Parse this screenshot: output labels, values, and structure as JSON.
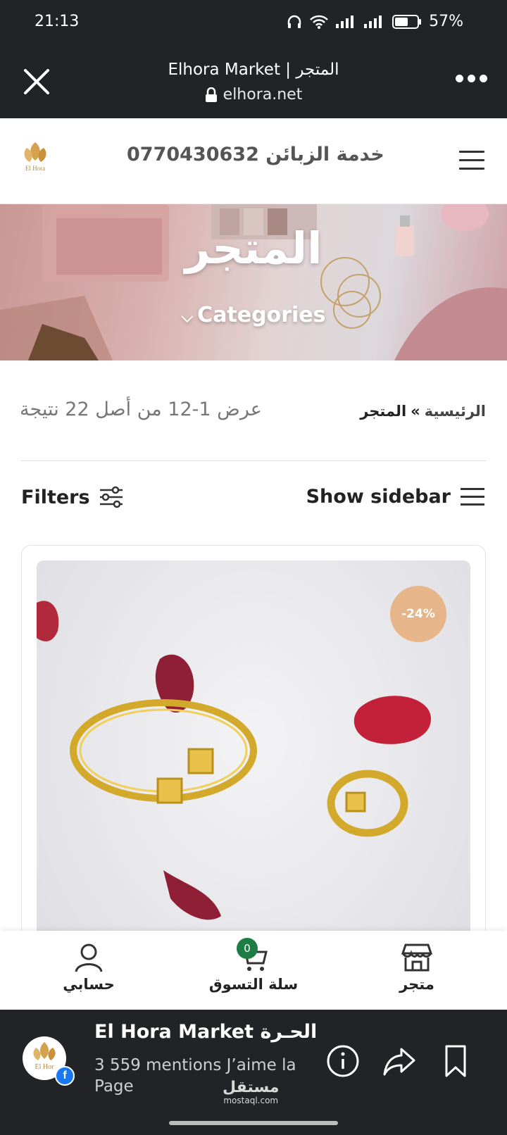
{
  "status_bar": {
    "time": "21:13",
    "battery": "57%"
  },
  "browser": {
    "title": "Elhora Market | المتجر",
    "url": "elhora.net"
  },
  "header": {
    "support_text": "خدمة الزبائن  0770430632",
    "logo_text": "El Hora"
  },
  "hero": {
    "title": "المتجر",
    "categories_label": "Categories"
  },
  "breadcrumb": {
    "home": "الرئيسية",
    "separator": "»",
    "current": "المتجر"
  },
  "result_count": "عرض 1-12 من أصل 22 نتيجة",
  "toolbar": {
    "filters_label": "Filters",
    "sidebar_label": "Show sidebar"
  },
  "product": {
    "sale_badge": "-24%"
  },
  "bottom_nav": {
    "account_label": "حسابي",
    "cart_label": "سلة التسوق",
    "cart_count": "0",
    "shop_label": "متجر"
  },
  "facebook": {
    "page_name": "El Hora Market الحـرة",
    "likes": "3 559 mentions J’aime la Page",
    "avatar_text": "El Hor",
    "watermark": "مستقل",
    "watermark_sub": "mostaql.com"
  },
  "colors": {
    "dark_bar": "#222326",
    "sale_badge": "#e6b58a",
    "cart_badge": "#1d7d45",
    "brand_gold": "#d4a24c"
  }
}
